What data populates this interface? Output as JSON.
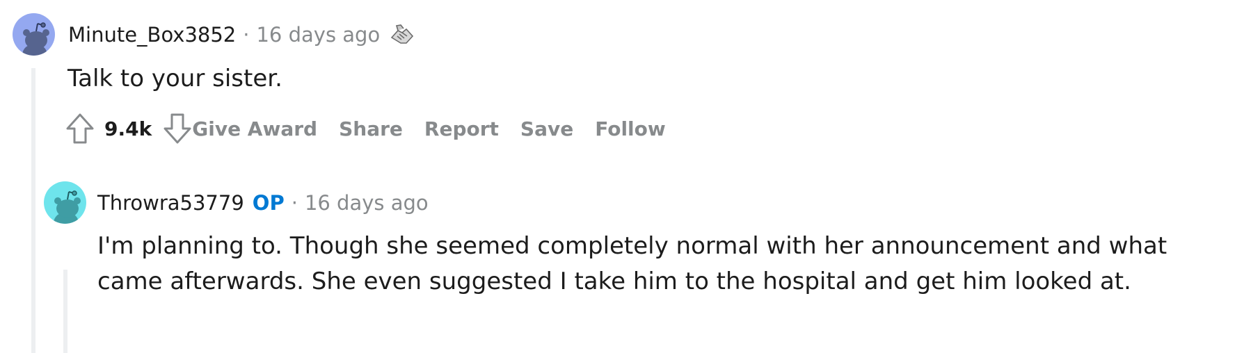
{
  "colors": {
    "text": "#1c1c1c",
    "meta": "#878a8c",
    "op": "#0079d3",
    "thread_line": "#edeff1",
    "avatar1_bg": "#94a8f0",
    "avatar2_bg": "#6ee4ec"
  },
  "comments": [
    {
      "username": "Minute_Box3852",
      "time": "16 days ago",
      "separator": "·",
      "award_icon": "handshake-award-icon",
      "body": "Talk to your sister.",
      "score": "9.4k",
      "actions": [
        "Give Award",
        "Share",
        "Report",
        "Save",
        "Follow"
      ]
    },
    {
      "username": "Throwra53779",
      "flair": "OP",
      "separator": "·",
      "time": "16 days ago",
      "body_line1": "I'm planning to. Though she seemed completely normal with her announcement and what",
      "body_line2": "came afterwards. She even suggested I take him to the hospital and get him looked at."
    }
  ]
}
